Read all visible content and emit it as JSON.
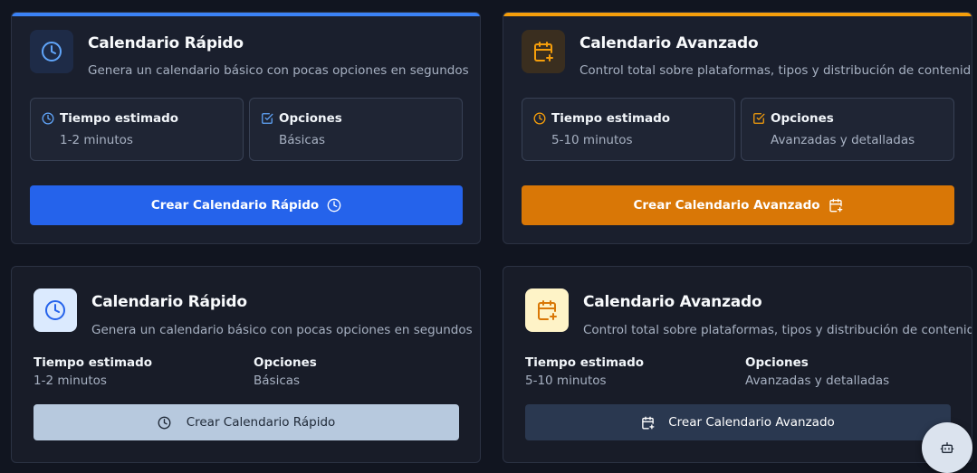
{
  "quick_card_dark": {
    "accent": "#2563eb",
    "title": "Calendario Rápido",
    "description": "Genera un calendario básico con pocas opciones en segundos",
    "time_label": "Tiempo estimado",
    "time_value": "1-2 minutos",
    "options_label": "Opciones",
    "options_value": "Básicas",
    "button_label": "Crear Calendario Rápido"
  },
  "advanced_card_dark": {
    "accent": "#d97706",
    "title": "Calendario Avanzado",
    "description": "Control total sobre plataformas, tipos y distribución de contenido",
    "time_label": "Tiempo estimado",
    "time_value": "5-10 minutos",
    "options_label": "Opciones",
    "options_value": "Avanzadas y detalladas",
    "button_label": "Crear Calendario Avanzado"
  },
  "quick_card_light": {
    "title": "Calendario Rápido",
    "description": "Genera un calendario básico con pocas opciones en segundos",
    "time_label": "Tiempo estimado",
    "time_value": "1-2 minutos",
    "options_label": "Opciones",
    "options_value": "Básicas",
    "button_label": "Crear Calendario Rápido"
  },
  "advanced_card_light": {
    "title": "Calendario Avanzado",
    "description": "Control total sobre plataformas, tipos y distribución de contenido",
    "time_label": "Tiempo estimado",
    "time_value": "5-10 minutos",
    "options_label": "Opciones",
    "options_value": "Avanzadas y detalladas",
    "button_label": "Crear Calendario Avanzado"
  },
  "icons": {
    "clock": "clock-icon",
    "calendar_plus": "calendar-plus-icon",
    "check_square": "check-square-icon",
    "robot": "robot-icon"
  }
}
